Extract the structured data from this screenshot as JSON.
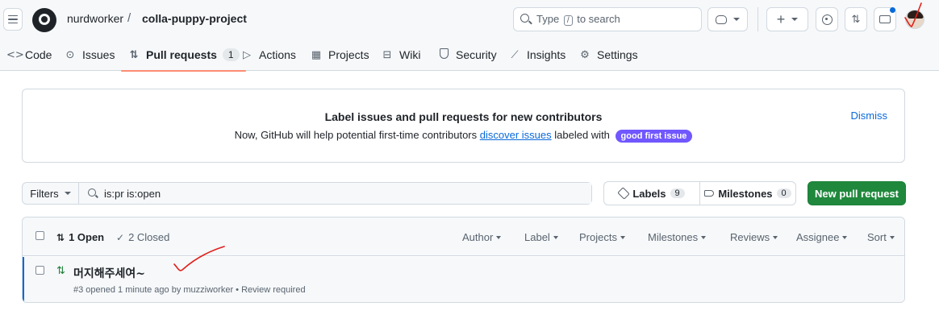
{
  "header": {
    "owner": "nurdworker",
    "separator": "/",
    "repo": "colla-puppy-project",
    "search_prefix": "Type",
    "search_key": "/",
    "search_suffix": "to search"
  },
  "nav": {
    "tabs": [
      {
        "label": "Code",
        "icon": "code-icon"
      },
      {
        "label": "Issues",
        "icon": "issue-icon"
      },
      {
        "label": "Pull requests",
        "icon": "pull-request-icon",
        "count": "1",
        "selected": true
      },
      {
        "label": "Actions",
        "icon": "play-icon"
      },
      {
        "label": "Projects",
        "icon": "table-icon"
      },
      {
        "label": "Wiki",
        "icon": "book-icon"
      },
      {
        "label": "Security",
        "icon": "shield-icon"
      },
      {
        "label": "Insights",
        "icon": "graph-icon"
      },
      {
        "label": "Settings",
        "icon": "gear-icon"
      }
    ]
  },
  "banner": {
    "title": "Label issues and pull requests for new contributors",
    "text_before": "Now, GitHub will help potential first-time contributors",
    "link": "discover issues",
    "text_after": "labeled with",
    "badge": "good first issue",
    "dismiss": "Dismiss"
  },
  "filters": {
    "button": "Filters",
    "query": "is:pr is:open",
    "labels": "Labels",
    "labels_count": "9",
    "milestones": "Milestones",
    "milestones_count": "0",
    "new_pr": "New pull request"
  },
  "list": {
    "open": "1 Open",
    "closed": "2 Closed",
    "sorts": [
      "Author",
      "Label",
      "Projects",
      "Milestones",
      "Reviews",
      "Assignee",
      "Sort"
    ],
    "items": [
      {
        "title": "머지해주세여~",
        "meta": "#3 opened 1 minute ago by muzziworker • Review required"
      }
    ]
  },
  "colors": {
    "accent": "#0969da",
    "primary_button": "#1f883d",
    "selected_tab_underline": "#fd8c73",
    "label_badge": "#7057ff",
    "annotation_ink": "#e0201b"
  }
}
